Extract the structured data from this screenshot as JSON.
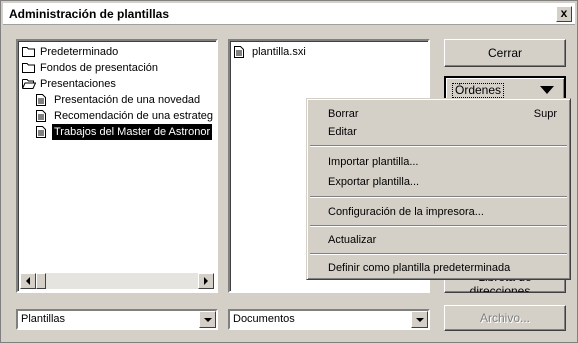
{
  "window": {
    "title": "Administración de plantillas",
    "close_glyph": "x"
  },
  "tree": {
    "items": [
      {
        "label": "Predeterminado",
        "icon": "folder-icon",
        "indent": 0
      },
      {
        "label": "Fondos de presentación",
        "icon": "folder-icon",
        "indent": 0
      },
      {
        "label": "Presentaciones",
        "icon": "open-folder-icon",
        "indent": 0
      },
      {
        "label": "Presentación de una novedad",
        "icon": "document-icon",
        "indent": 1
      },
      {
        "label": "Recomendación de una estrateg",
        "icon": "document-icon",
        "indent": 1
      },
      {
        "label": "Trabajos del Master de Astronor",
        "icon": "document-icon",
        "indent": 1,
        "selected": true
      }
    ]
  },
  "docs": {
    "items": [
      {
        "label": "plantilla.sxi",
        "icon": "document-icon"
      }
    ]
  },
  "buttons": {
    "close": "Cerrar",
    "orders": "Órdenes",
    "address_book": "Libreta de direcciones...",
    "archive": "Archivo..."
  },
  "combos": {
    "left_value": "Plantillas",
    "right_value": "Documentos"
  },
  "context_menu": {
    "items": [
      {
        "label": "Borrar",
        "shortcut": "Supr"
      },
      {
        "label": "Editar",
        "shortcut": ""
      },
      {
        "separator": true
      },
      {
        "label": "Importar plantilla...",
        "shortcut": ""
      },
      {
        "label": "Exportar plantilla...",
        "shortcut": ""
      },
      {
        "separator": true
      },
      {
        "label": "Configuración de la impresora...",
        "shortcut": ""
      },
      {
        "separator": true
      },
      {
        "label": "Actualizar",
        "shortcut": ""
      },
      {
        "separator": true
      },
      {
        "label": "Definir como plantilla predeterminada",
        "shortcut": ""
      }
    ]
  }
}
